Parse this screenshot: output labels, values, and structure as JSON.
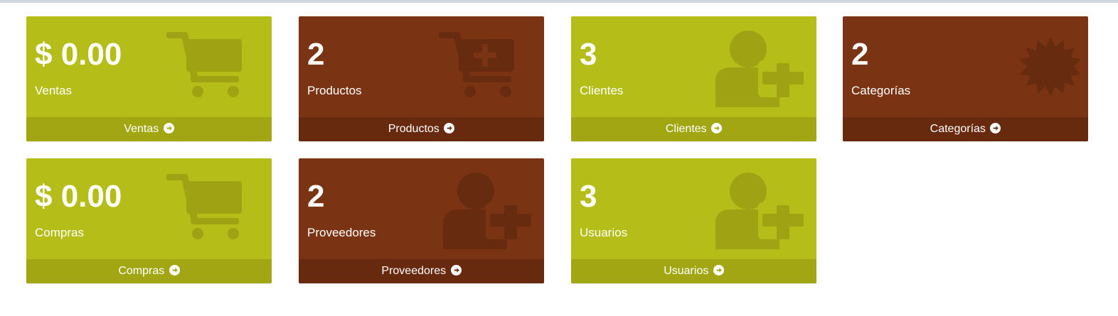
{
  "colors": {
    "olive": "#b5bd18",
    "olive_footer": "#a2a612",
    "olive_icon": "#9ea213",
    "brown": "#7a3413",
    "brown_footer": "#682a0f",
    "brown_icon": "#672c10"
  },
  "boxes": [
    {
      "value": "$ 0.00",
      "label": "Ventas",
      "link": "Ventas",
      "color": "olive",
      "icon": "shopping-cart-icon"
    },
    {
      "value": "2",
      "label": "Productos",
      "link": "Productos",
      "color": "brown",
      "icon": "cart-plus-icon"
    },
    {
      "value": "3",
      "label": "Clientes",
      "link": "Clientes",
      "color": "olive",
      "icon": "user-plus-icon"
    },
    {
      "value": "2",
      "label": "Categorías",
      "link": "Categorías",
      "color": "brown",
      "icon": "certificate-icon"
    },
    {
      "value": "$ 0.00",
      "label": "Compras",
      "link": "Compras",
      "color": "olive",
      "icon": "shopping-cart-icon"
    },
    {
      "value": "2",
      "label": "Proveedores",
      "link": "Proveedores",
      "color": "brown",
      "icon": "user-plus-icon"
    },
    {
      "value": "3",
      "label": "Usuarios",
      "link": "Usuarios",
      "color": "olive",
      "icon": "user-plus-icon"
    }
  ]
}
